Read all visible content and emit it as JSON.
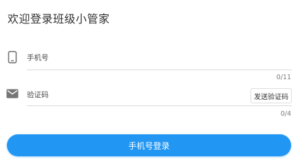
{
  "header": {
    "title": "欢迎登录班级小管家"
  },
  "phone": {
    "icon": "smartphone-icon",
    "placeholder": "手机号",
    "value": "",
    "counter": "0/11"
  },
  "code": {
    "icon": "mail-icon",
    "placeholder": "验证码",
    "value": "",
    "counter": "0/4",
    "send_label": "发送验证码"
  },
  "login": {
    "label": "手机号登录"
  },
  "colors": {
    "accent": "#2196f3",
    "icon": "#757575",
    "divider": "#d9d9d9"
  }
}
